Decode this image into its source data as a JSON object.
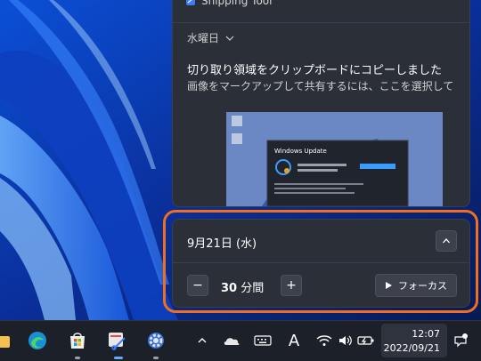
{
  "notification_center": {
    "app_name": "Snipping Tool",
    "day_header": "水曜日",
    "notification": {
      "title": "切り取り領域をクリップボードにコピーしました",
      "body": "画像をマークアップして共有するには、ここを選択してくだ"
    },
    "thumbnail": {
      "dialog_title": "Windows Update"
    }
  },
  "focus": {
    "date": "9月21日 (水)",
    "minutes_value": "30",
    "minutes_unit": "分間",
    "decrease_label": "−",
    "increase_label": "+",
    "focus_button_label": "フォーカス"
  },
  "taskbar": {
    "time": "12:07",
    "date": "2022/09/21",
    "pinned_icons": [
      "file-explorer-icon",
      "edge-icon",
      "store-icon",
      "snipping-tool-icon",
      "settings-icon"
    ],
    "tray_icons": [
      "chevron-up-icon",
      "onedrive-icon",
      "keyboard-icon",
      "ime-icon",
      "wifi-icon",
      "volume-icon",
      "battery-icon",
      "notification-icon"
    ],
    "ime_label": "A"
  },
  "colors": {
    "highlight": "#f26d1d",
    "panel": "#2b2f38",
    "taskbar": "#1c2029"
  }
}
